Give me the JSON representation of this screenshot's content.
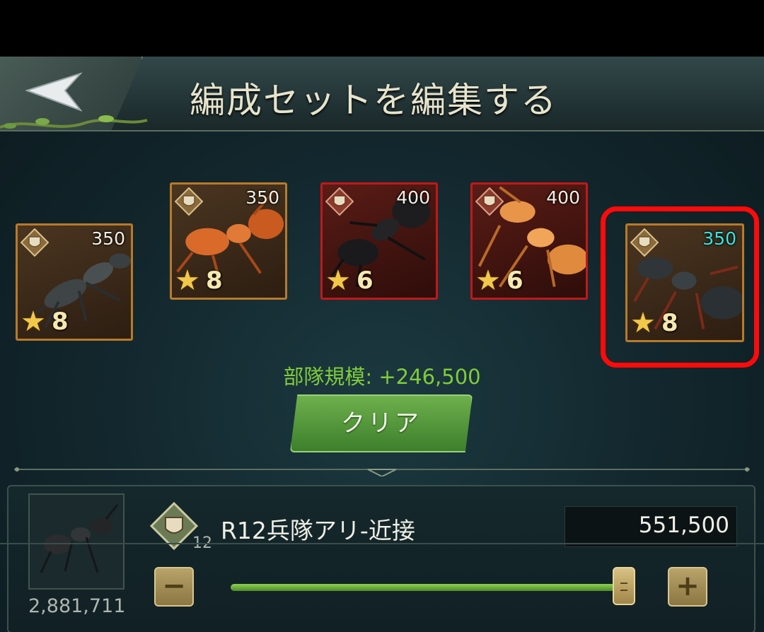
{
  "header": {
    "title": "編成セットを編集する",
    "back_icon": "back-arrow-icon"
  },
  "cards": [
    {
      "power": "350",
      "stars": "8",
      "frame": "gold",
      "ant_color": "#3f4446",
      "power_color": "#f3efe4"
    },
    {
      "power": "350",
      "stars": "8",
      "frame": "gold",
      "ant_color": "#d96a2a",
      "power_color": "#f3efe4"
    },
    {
      "power": "400",
      "stars": "6",
      "frame": "red",
      "ant_color": "#1d1d1f",
      "power_color": "#f3efe4"
    },
    {
      "power": "400",
      "stars": "6",
      "frame": "red",
      "ant_color": "#e8954a",
      "power_color": "#f3efe4"
    },
    {
      "power": "350",
      "stars": "8",
      "frame": "gold",
      "ant_color": "#2f3538",
      "power_color": "#33e6e6",
      "highlighted": true
    }
  ],
  "troop_size": "部隊規模: +246,500",
  "clear_label": "クリア",
  "unit": {
    "available": "2,881,711",
    "level": "12",
    "name": "R12兵隊アリ-近接",
    "value": "551,500",
    "slider_fraction": 1.0,
    "minus_label": "−",
    "plus_label": "+"
  },
  "colors": {
    "accent_green": "#7fcc3a",
    "highlight_red": "#ff0a0a",
    "gold_frame": "#b87a2a",
    "red_frame": "#c21818"
  }
}
